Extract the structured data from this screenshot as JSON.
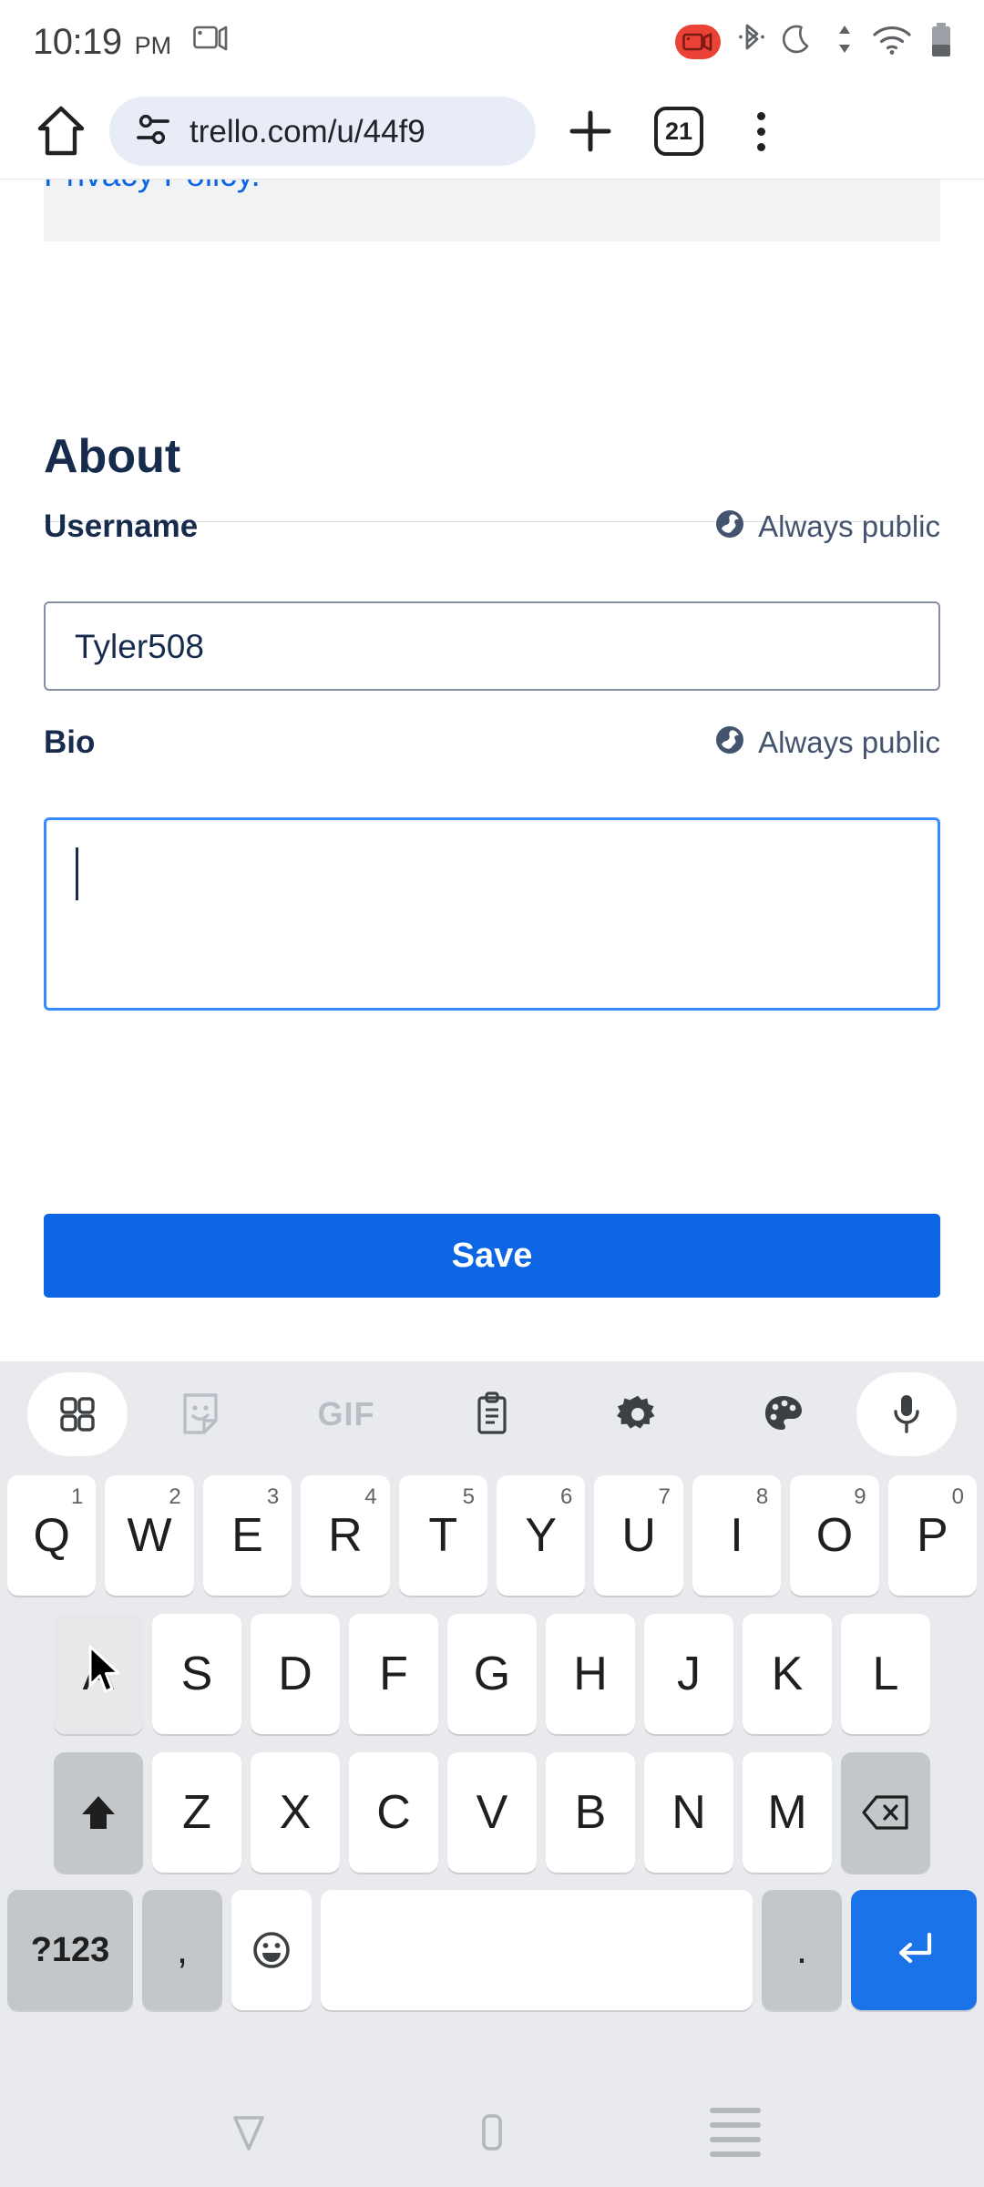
{
  "status_bar": {
    "time": "10:19",
    "ampm": "PM",
    "icons": [
      "cast-icon",
      "screen-recording-icon",
      "bluetooth-icon",
      "do-not-disturb-moon-icon",
      "data-transfer-icon",
      "wifi-icon",
      "battery-icon"
    ]
  },
  "browser": {
    "home_icon": "home-icon",
    "site_settings_icon": "tune-icon",
    "url": "trello.com/u/44f9",
    "new_tab_icon": "plus-icon",
    "tab_count": "21",
    "menu_icon": "three-dot-menu-icon"
  },
  "page": {
    "privacy_link": "Privacy Policy.",
    "heading": "About",
    "username": {
      "label": "Username",
      "visibility": "Always public",
      "visibility_icon": "globe-icon",
      "value": "Tyler508"
    },
    "bio": {
      "label": "Bio",
      "visibility": "Always public",
      "visibility_icon": "globe-icon",
      "value": ""
    },
    "save_label": "Save"
  },
  "keyboard": {
    "toolbar": [
      {
        "name": "grid-icon",
        "label": ""
      },
      {
        "name": "sticker-icon",
        "label": ""
      },
      {
        "name": "gif-icon",
        "label": "GIF"
      },
      {
        "name": "clipboard-icon",
        "label": ""
      },
      {
        "name": "settings-gear-icon",
        "label": ""
      },
      {
        "name": "palette-icon",
        "label": ""
      },
      {
        "name": "microphone-icon",
        "label": ""
      }
    ],
    "row1": [
      {
        "letter": "Q",
        "sup": "1"
      },
      {
        "letter": "W",
        "sup": "2"
      },
      {
        "letter": "E",
        "sup": "3"
      },
      {
        "letter": "R",
        "sup": "4"
      },
      {
        "letter": "T",
        "sup": "5"
      },
      {
        "letter": "Y",
        "sup": "6"
      },
      {
        "letter": "U",
        "sup": "7"
      },
      {
        "letter": "I",
        "sup": "8"
      },
      {
        "letter": "O",
        "sup": "9"
      },
      {
        "letter": "P",
        "sup": "0"
      }
    ],
    "row2": [
      {
        "letter": "A"
      },
      {
        "letter": "S"
      },
      {
        "letter": "D"
      },
      {
        "letter": "F"
      },
      {
        "letter": "G"
      },
      {
        "letter": "H"
      },
      {
        "letter": "J"
      },
      {
        "letter": "K"
      },
      {
        "letter": "L"
      }
    ],
    "row3": [
      {
        "letter": "Z"
      },
      {
        "letter": "X"
      },
      {
        "letter": "C"
      },
      {
        "letter": "V"
      },
      {
        "letter": "B"
      },
      {
        "letter": "N"
      },
      {
        "letter": "M"
      }
    ],
    "shift_icon": "shift-up-arrow-icon",
    "backspace_icon": "backspace-icon",
    "symbols_label": "?123",
    "comma_label": ",",
    "emoji_icon": "emoji-smiley-icon",
    "space_label": "",
    "period_label": ".",
    "enter_icon": "enter-return-icon"
  },
  "nav_bar": {
    "back_icon": "back-triangle-icon",
    "home_icon": "home-square-icon",
    "recents_icon": "recents-lines-icon"
  },
  "colors": {
    "accent_blue": "#0c66e4",
    "focus_blue": "#388bff",
    "heading_navy": "#172b4d",
    "keyboard_bg": "#e8eaed",
    "record_red": "#ea4335",
    "enter_blue": "#1a73e8"
  }
}
